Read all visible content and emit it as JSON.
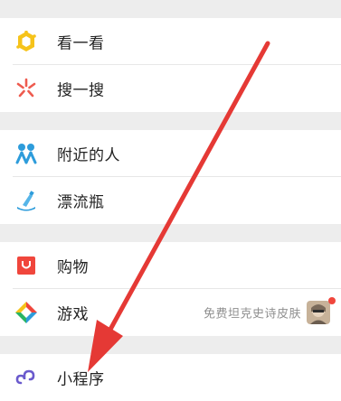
{
  "colors": {
    "background": "#ededed",
    "row": "#ffffff",
    "annotation_arrow": "#e53935",
    "red_dot": "#f0463c"
  },
  "menu": {
    "group1": [
      {
        "label": "看一看",
        "icon": "look-icon"
      },
      {
        "label": "搜一搜",
        "icon": "search-spark-icon"
      }
    ],
    "group2": [
      {
        "label": "附近的人",
        "icon": "people-nearby-icon"
      },
      {
        "label": "漂流瓶",
        "icon": "drift-bottle-icon"
      }
    ],
    "group3": [
      {
        "label": "购物",
        "icon": "shopping-icon"
      },
      {
        "label": "游戏",
        "icon": "game-icon",
        "promo": "免费坦克史诗皮肤",
        "has_avatar": true,
        "has_red_dot": true
      }
    ],
    "group4": [
      {
        "label": "小程序",
        "icon": "mini-program-icon"
      }
    ]
  }
}
